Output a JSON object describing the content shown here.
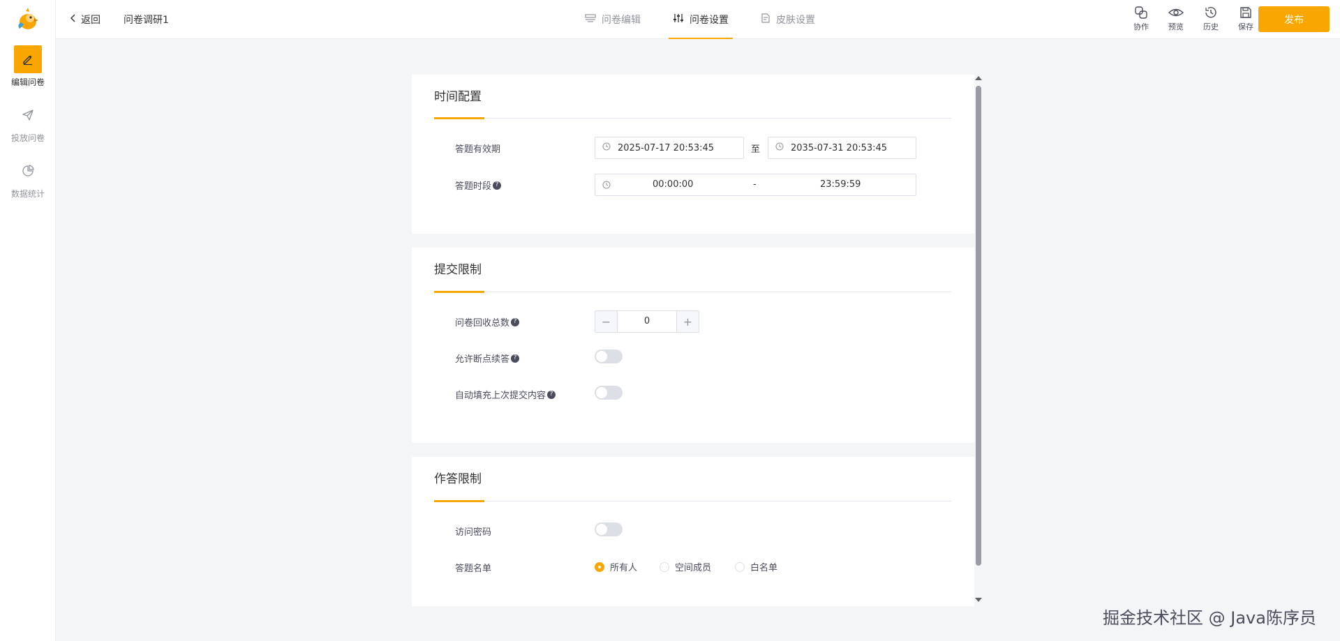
{
  "sidebar": {
    "logo_icon": "bird-logo-icon",
    "items": [
      {
        "label": "编辑问卷",
        "icon": "edit-icon",
        "active": true
      },
      {
        "label": "投放问卷",
        "icon": "send-icon",
        "active": false
      },
      {
        "label": "数据统计",
        "icon": "pie-chart-icon",
        "active": false
      }
    ]
  },
  "header": {
    "back_label": "返回",
    "survey_title": "问卷调研1",
    "tabs": [
      {
        "label": "问卷编辑",
        "icon": "form-edit-icon",
        "active": false
      },
      {
        "label": "问卷设置",
        "icon": "sliders-icon",
        "active": true
      },
      {
        "label": "皮肤设置",
        "icon": "skin-icon",
        "active": false
      }
    ],
    "tools": [
      {
        "label": "协作",
        "icon": "collaborate-icon"
      },
      {
        "label": "预览",
        "icon": "eye-icon"
      },
      {
        "label": "历史",
        "icon": "history-icon"
      },
      {
        "label": "保存",
        "icon": "save-icon"
      }
    ],
    "publish_label": "发布"
  },
  "sections": {
    "time": {
      "title": "时间配置",
      "validity_label": "答题有效期",
      "start_date": "2025-07-17 20:53:45",
      "to_label": "至",
      "end_date": "2035-07-31 20:53:45",
      "period_label": "答题时段",
      "period_start": "00:00:00",
      "period_sep": "-",
      "period_end": "23:59:59"
    },
    "submit": {
      "title": "提交限制",
      "total_label": "问卷回收总数",
      "total_value": "0",
      "resume_label": "允许断点续答",
      "resume_on": false,
      "autofill_label": "自动填充上次提交内容",
      "autofill_on": false
    },
    "answer": {
      "title": "作答限制",
      "password_label": "访问密码",
      "password_on": false,
      "list_label": "答题名单",
      "options": [
        "所有人",
        "空间成员",
        "白名单"
      ],
      "selected": "所有人"
    }
  },
  "watermark": "掘金技术社区 @ Java陈序员",
  "colors": {
    "accent": "#faa600",
    "text": "#303133",
    "muted": "#92949d",
    "background": "#f4f5f7"
  }
}
